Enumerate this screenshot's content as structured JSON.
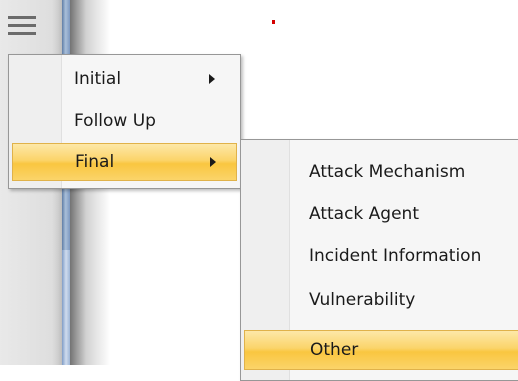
{
  "main_menu": {
    "items": [
      {
        "label": "Initial",
        "has_submenu": true,
        "selected": false
      },
      {
        "label": "Follow Up",
        "has_submenu": false,
        "selected": false
      },
      {
        "label": "Final",
        "has_submenu": true,
        "selected": true
      }
    ]
  },
  "submenu": {
    "items": [
      {
        "label": "Attack Mechanism",
        "selected": false
      },
      {
        "label": "Attack Agent",
        "selected": false
      },
      {
        "label": "Incident Information",
        "selected": false
      },
      {
        "label": "Vulnerability",
        "selected": false
      },
      {
        "label": "Other",
        "selected": true
      }
    ]
  },
  "colors": {
    "highlight": "#fbd46a",
    "menu_background": "#f6f6f6",
    "window_frame_blue": "#a9bfd9"
  },
  "icons": {
    "menu_toggle": "hamburger-menu-icon",
    "submenu_indicator": "triangle-right-icon"
  }
}
